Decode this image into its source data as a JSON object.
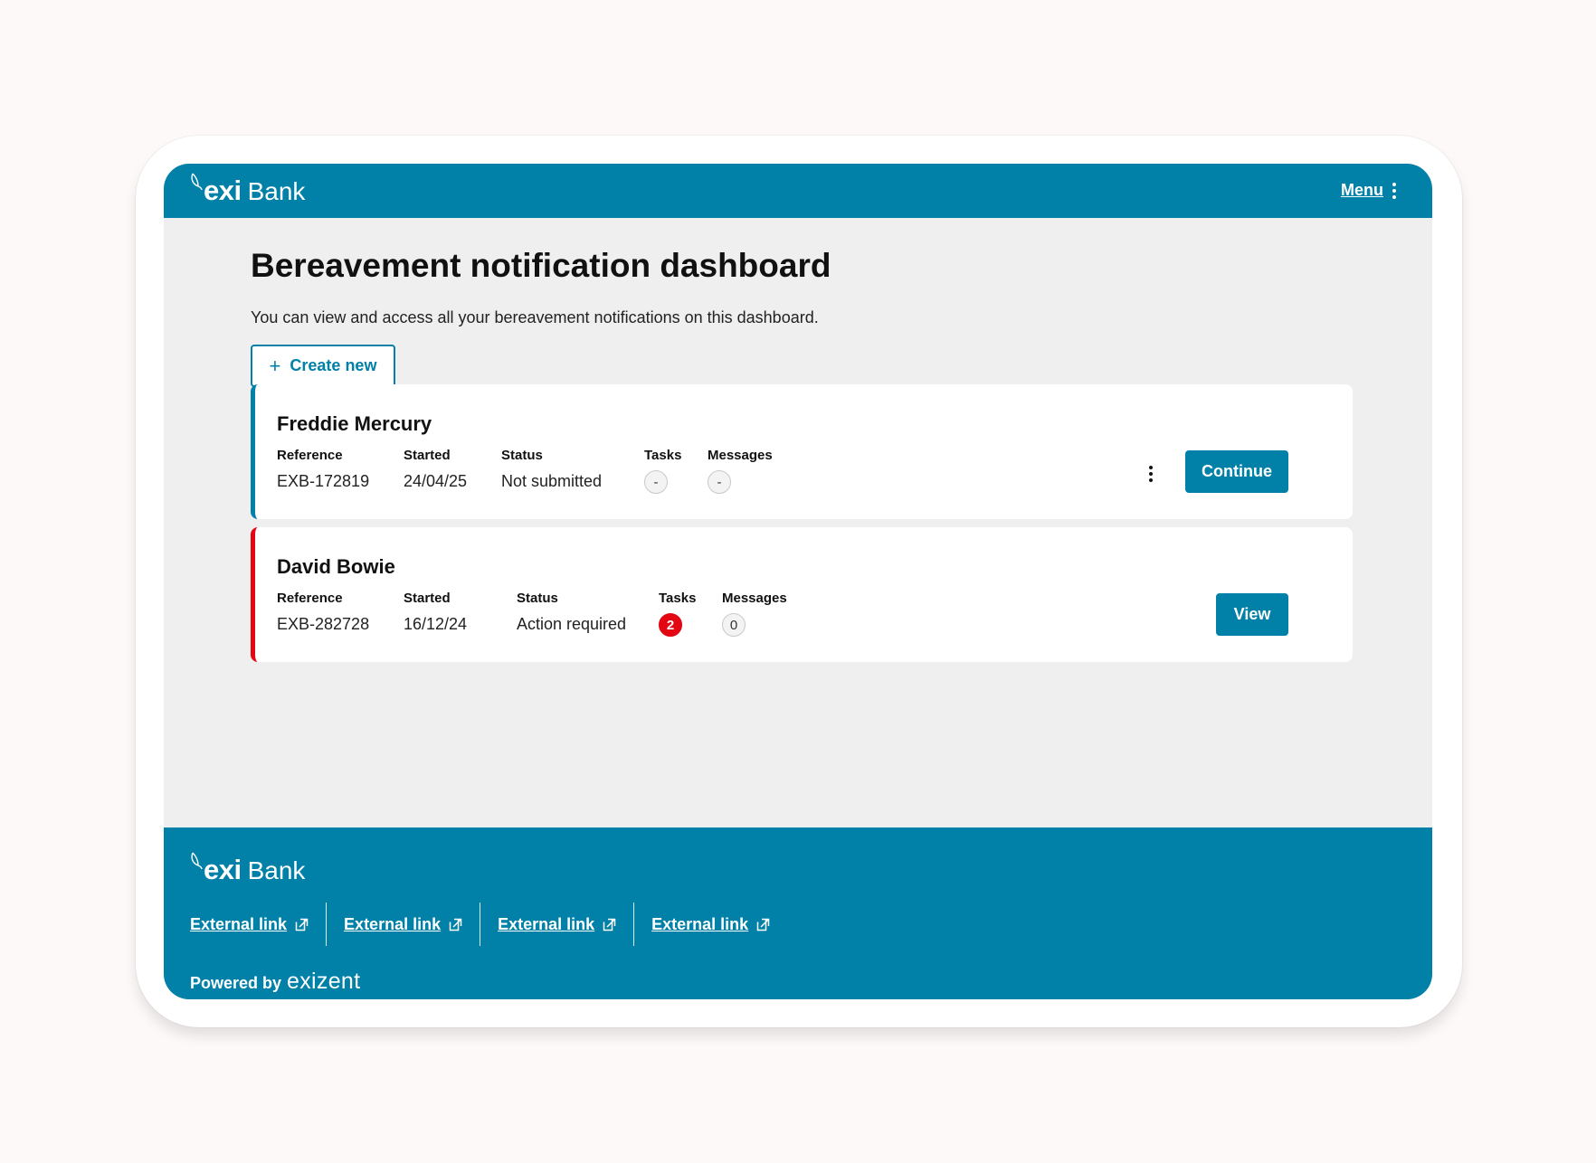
{
  "brand": {
    "logo_word": "exi",
    "logo_name": "Bank"
  },
  "header": {
    "menu_label": "Menu"
  },
  "page": {
    "title": "Bereavement notification dashboard",
    "subtitle": "You can view and access all your bereavement notifications on this dashboard.",
    "create_label": "Create new"
  },
  "columns": {
    "reference": "Reference",
    "started": "Started",
    "status": "Status",
    "tasks": "Tasks",
    "messages": "Messages"
  },
  "cards": [
    {
      "name": "Freddie Mercury",
      "reference": "EXB-172819",
      "started": "24/04/25",
      "status": "Not submitted",
      "tasks": "-",
      "messages": "-",
      "action_label": "Continue",
      "accent": "#0180a8"
    },
    {
      "name": "David Bowie",
      "reference": "EXB-282728",
      "started": "16/12/24",
      "status": "Action required",
      "tasks": "2",
      "messages": "0",
      "action_label": "View",
      "accent": "#e30613"
    }
  ],
  "footer": {
    "links": [
      "External link",
      "External link",
      "External link",
      "External link"
    ],
    "powered_by": "Powered by",
    "powered_brand": "exizent"
  },
  "colors": {
    "primary": "#0180a8",
    "alert": "#e30613",
    "background": "#efefef"
  }
}
